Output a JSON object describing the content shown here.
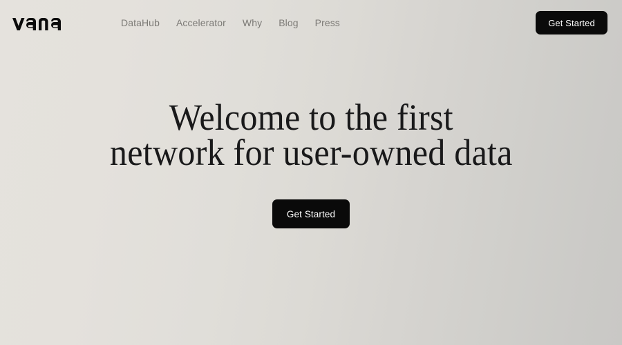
{
  "theme": {
    "background_left": "#E4E1DC",
    "background_mid": "#DEDCD7",
    "background_right": "#CBCAC7",
    "button_bg": "#0A0A0A",
    "button_text": "#FFFFFF",
    "nav_text": "#7C7A76",
    "headline_text": "#19191A"
  },
  "header": {
    "logo": {
      "wordmark": "vana",
      "icon_name": "vana-wordmark-logo"
    },
    "nav": [
      {
        "label": "DataHub"
      },
      {
        "label": "Accelerator"
      },
      {
        "label": "Why"
      },
      {
        "label": "Blog"
      },
      {
        "label": "Press"
      }
    ],
    "cta": {
      "label": "Get Started"
    }
  },
  "hero": {
    "headline_line_1": "Welcome to the first",
    "headline_line_2": "network for user-owned data",
    "cta": {
      "label": "Get Started"
    }
  }
}
